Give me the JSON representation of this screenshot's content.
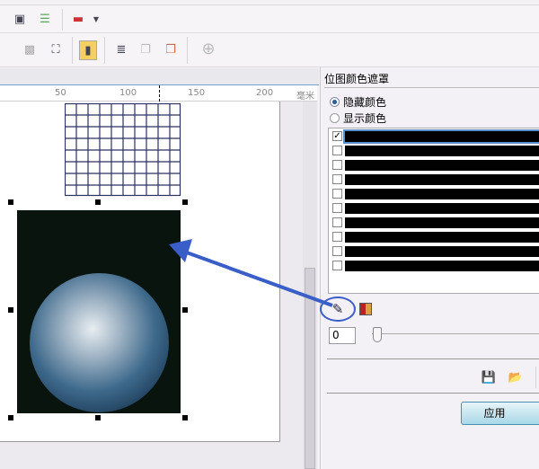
{
  "ruler": {
    "ticks": [
      "50",
      "100",
      "150",
      "200"
    ],
    "unit": "毫米"
  },
  "panel": {
    "title": "位图颜色遮罩",
    "options": [
      {
        "label": "隐藏颜色",
        "selected": true
      },
      {
        "label": "显示颜色",
        "selected": false
      }
    ],
    "colors": [
      {
        "checked": true,
        "color": "#000000"
      },
      {
        "checked": false,
        "color": "#000000"
      },
      {
        "checked": false,
        "color": "#000000"
      },
      {
        "checked": false,
        "color": "#000000"
      },
      {
        "checked": false,
        "color": "#000000"
      },
      {
        "checked": false,
        "color": "#000000"
      },
      {
        "checked": false,
        "color": "#000000"
      },
      {
        "checked": false,
        "color": "#000000"
      },
      {
        "checked": false,
        "color": "#000000"
      },
      {
        "checked": false,
        "color": "#000000"
      }
    ],
    "tolerance_value": "0",
    "tolerance_slider": 0,
    "apply_label": "应用",
    "check_mark": "✓"
  },
  "accent": "#3a5ec8"
}
